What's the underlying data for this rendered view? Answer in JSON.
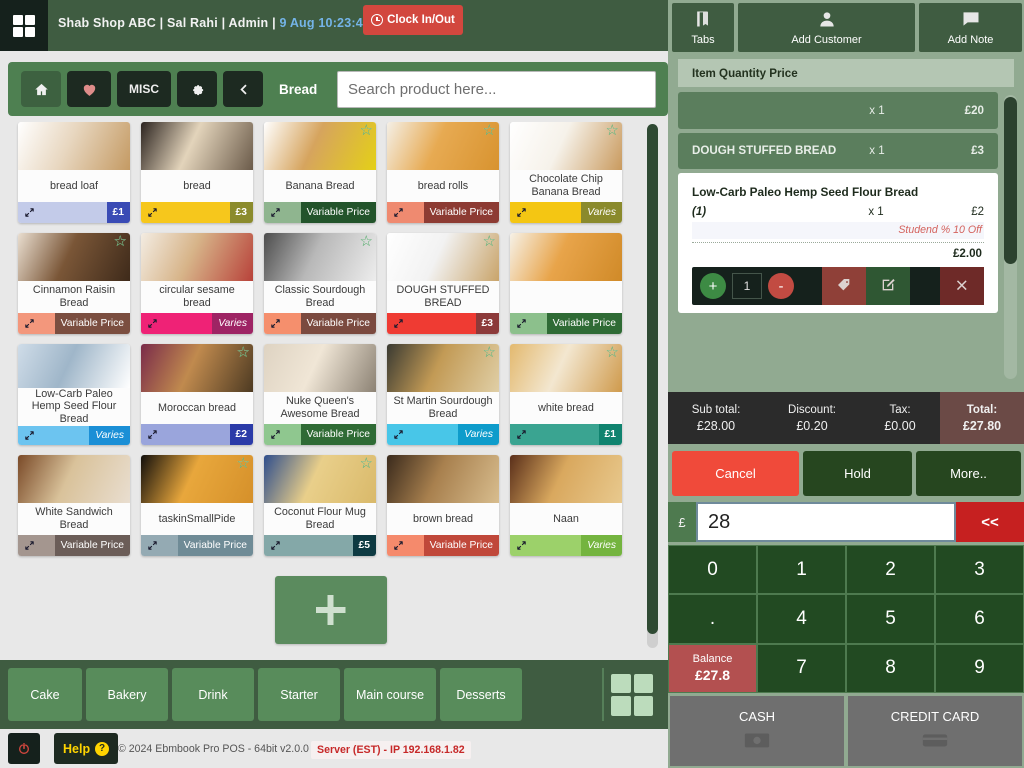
{
  "header": {
    "store_line": "Shab Shop ABC | Sal Rahi | Admin | ",
    "datetime": "9 Aug 10:23:4",
    "clock_button": "Clock In/Out",
    "app_menu_icon": "grid-icon"
  },
  "toolbar": {
    "home_icon": "home-icon",
    "favourites_icon": "heart-icon",
    "misc_label": "MISC",
    "settings_icon": "gear-icon",
    "back_icon": "chevron-left-icon",
    "category_label": "Bread",
    "search_placeholder": "Search product here...",
    "search_value": ""
  },
  "products": [
    {
      "name": "bread loaf",
      "price_label": "£1",
      "badge_style": "price",
      "fav": false,
      "thumb": [
        "#ffffff",
        "#e8d7c0",
        "#c49a63"
      ],
      "accent": "#3a4bb5",
      "light": "#c3cbe9"
    },
    {
      "name": "bread",
      "price_label": "£3",
      "badge_style": "price",
      "fav": false,
      "thumb": [
        "#2c2420",
        "#e3d4bb",
        "#6b5b4a"
      ],
      "accent": "#8b8b2c",
      "light": "#f6c71c"
    },
    {
      "name": "Banana Bread",
      "price_label": "Variable Price",
      "badge_style": "varlabel",
      "fav": true,
      "thumb": [
        "#ffffff",
        "#d6a45e",
        "#e4d017"
      ],
      "accent": "#23542b",
      "light": "#8fb58f"
    },
    {
      "name": "bread rolls",
      "price_label": "Variable Price",
      "badge_style": "varlabel",
      "fav": true,
      "thumb": [
        "#f4efe6",
        "#e7aa52",
        "#d8932f"
      ],
      "accent": "#8d3b33",
      "light": "#ef8a70"
    },
    {
      "name": "Chocolate Chip Banana Bread",
      "price_label": "Varies",
      "badge_style": "varies",
      "fav": true,
      "thumb": [
        "#ffffff",
        "#f6f2ea",
        "#c99a5e"
      ],
      "accent": "#8a8a2c",
      "light": "#f4c613"
    },
    {
      "name": "Cinnamon Raisin Bread",
      "price_label": "Variable Price",
      "badge_style": "varlabel",
      "fav": true,
      "thumb": [
        "#e9ded0",
        "#7a5637",
        "#3e2a1a"
      ],
      "accent": "#7b4e40",
      "light": "#f3977c"
    },
    {
      "name": "circular sesame bread",
      "price_label": "Varies",
      "badge_style": "varies",
      "fav": false,
      "thumb": [
        "#f3ece2",
        "#d7b489",
        "#b8423a"
      ],
      "accent": "#9e2464",
      "light": "#ef2276"
    },
    {
      "name": "Classic Sourdough Bread",
      "price_label": "Variable Price",
      "badge_style": "varlabel",
      "fav": true,
      "thumb": [
        "#4d4d4d",
        "#b8b8b8",
        "#ededed"
      ],
      "accent": "#7b4a3f",
      "light": "#f58f6d"
    },
    {
      "name": "DOUGH STUFFED BREAD",
      "price_label": "£3",
      "badge_style": "price",
      "fav": true,
      "thumb": [
        "#ffffff",
        "#f2f2f2",
        "#c9a46a"
      ],
      "accent": "#8c3a3a",
      "light": "#ef3b33"
    },
    {
      "name": "",
      "price_label": "Variable Price",
      "badge_style": "varlabel",
      "fav": false,
      "thumb": [
        "#f6f1e7",
        "#e8a44a",
        "#d08a28"
      ],
      "accent": "#2f6b35",
      "light": "#8cc08c"
    },
    {
      "name": "Low-Carb Paleo Hemp Seed Flour Bread",
      "price_label": "Varies",
      "badge_style": "varies",
      "fav": false,
      "thumb": [
        "#cfdce8",
        "#9fb6c9",
        "#ffffff"
      ],
      "accent": "#1b8fd6",
      "light": "#6cc4f0"
    },
    {
      "name": "Moroccan bread",
      "price_label": "£2",
      "badge_style": "price",
      "fav": true,
      "thumb": [
        "#7a2b4a",
        "#c08a4e",
        "#4d3a22"
      ],
      "accent": "#2b3ba8",
      "light": "#9aa5dc"
    },
    {
      "name": "Nuke Queen's Awesome Bread",
      "price_label": "Variable Price",
      "badge_style": "varlabel",
      "fav": false,
      "thumb": [
        "#ded3c2",
        "#f0e6d6",
        "#8c8274"
      ],
      "accent": "#2f6b35",
      "light": "#8fc78f"
    },
    {
      "name": "St Martin Sourdough Bread",
      "price_label": "Varies",
      "badge_style": "varies",
      "fav": true,
      "thumb": [
        "#3a3a32",
        "#c29a55",
        "#e0cfa6"
      ],
      "accent": "#0e9ccb",
      "light": "#48c6e8"
    },
    {
      "name": "white bread",
      "price_label": "£1",
      "badge_style": "price",
      "fav": true,
      "thumb": [
        "#e3b96f",
        "#f3e7d0",
        "#cf9a4c"
      ],
      "accent": "#10836f",
      "light": "#3aa491"
    },
    {
      "name": "White Sandwich Bread",
      "price_label": "Variable Price",
      "badge_style": "varlabel",
      "fav": false,
      "thumb": [
        "#7a4a28",
        "#d9c29a",
        "#e9ded0"
      ],
      "accent": "#6b5d58",
      "light": "#a4968f"
    },
    {
      "name": "taskinSmallPide",
      "price_label": "Variable Price",
      "badge_style": "varlabel",
      "fav": true,
      "thumb": [
        "#120f0c",
        "#e8a73c",
        "#d5902a"
      ],
      "accent": "#6f8b96",
      "light": "#94aab3"
    },
    {
      "name": "Coconut Flour Mug Bread",
      "price_label": "£5",
      "badge_style": "price",
      "fav": true,
      "thumb": [
        "#2f4e8c",
        "#e9cf8a",
        "#d9b96a"
      ],
      "accent": "#0e3a42",
      "light": "#84a8a8"
    },
    {
      "name": "brown bread",
      "price_label": "Variable Price",
      "badge_style": "varlabel",
      "fav": false,
      "thumb": [
        "#3a2a1c",
        "#a8804e",
        "#d8bd8e"
      ],
      "accent": "#c0483a",
      "light": "#f58a6c"
    },
    {
      "name": "Naan",
      "price_label": "Varies",
      "badge_style": "varies",
      "fav": false,
      "thumb": [
        "#5a2f1a",
        "#d9a85e",
        "#e8c98e"
      ],
      "accent": "#74b43f",
      "light": "#9cd16a"
    }
  ],
  "add_product_icon": "plus-icon",
  "categories": [
    "Cake",
    "Bakery",
    "Drink",
    "Starter",
    "Main course",
    "Desserts"
  ],
  "category_grid_icon": "grid-icon",
  "footer": {
    "power_icon": "power-icon",
    "help_label": "Help",
    "copyright": "© 2024 Ebmbook Pro POS - 64bit v2.0.0 -",
    "server": "Server (EST) - IP 192.168.1.82"
  },
  "right": {
    "buttons": [
      {
        "label": "Tabs",
        "icon": "book-icon"
      },
      {
        "label": "Add Customer",
        "icon": "user-icon"
      },
      {
        "label": "Add Note",
        "icon": "note-icon"
      }
    ],
    "cart_header": "Item Quantity Price",
    "cart_rows": [
      {
        "name": "",
        "qty": "x 1",
        "price": "£20"
      },
      {
        "name": "DOUGH STUFFED BREAD",
        "qty": "x 1",
        "price": "£3"
      }
    ],
    "selected_item": {
      "name": "Low-Carb Paleo Hemp Seed Flour Bread",
      "line_number": "(1)",
      "qty": "x 1",
      "price": "£2",
      "discount_note": "Studend % 10 Off",
      "line_total": "£2.00",
      "quantity_value": "1",
      "plus_label": "+",
      "minus_label": "-",
      "tag_icon": "tag-icon",
      "edit_icon": "edit-icon",
      "remove_icon": "close-icon"
    },
    "totals": {
      "subtotal_label": "Sub total:",
      "subtotal_value": "£28.00",
      "discount_label": "Discount:",
      "discount_value": "£0.20",
      "tax_label": "Tax:",
      "tax_value": "£0.00",
      "total_label": "Total:",
      "total_value": "£27.80"
    },
    "actions": {
      "cancel": "Cancel",
      "hold": "Hold",
      "more": "More.."
    },
    "amount": {
      "currency": "£",
      "value": "28",
      "backspace": "<<"
    },
    "keypad": [
      "0",
      "1",
      "2",
      "3",
      ".",
      "4",
      "5",
      "6",
      "7",
      "8",
      "9"
    ],
    "balance": {
      "label": "Balance",
      "value": "£27.8"
    },
    "payment": [
      {
        "label": "CASH",
        "icon": "cash-icon"
      },
      {
        "label": "CREDIT CARD",
        "icon": "credit-card-icon"
      }
    ]
  }
}
